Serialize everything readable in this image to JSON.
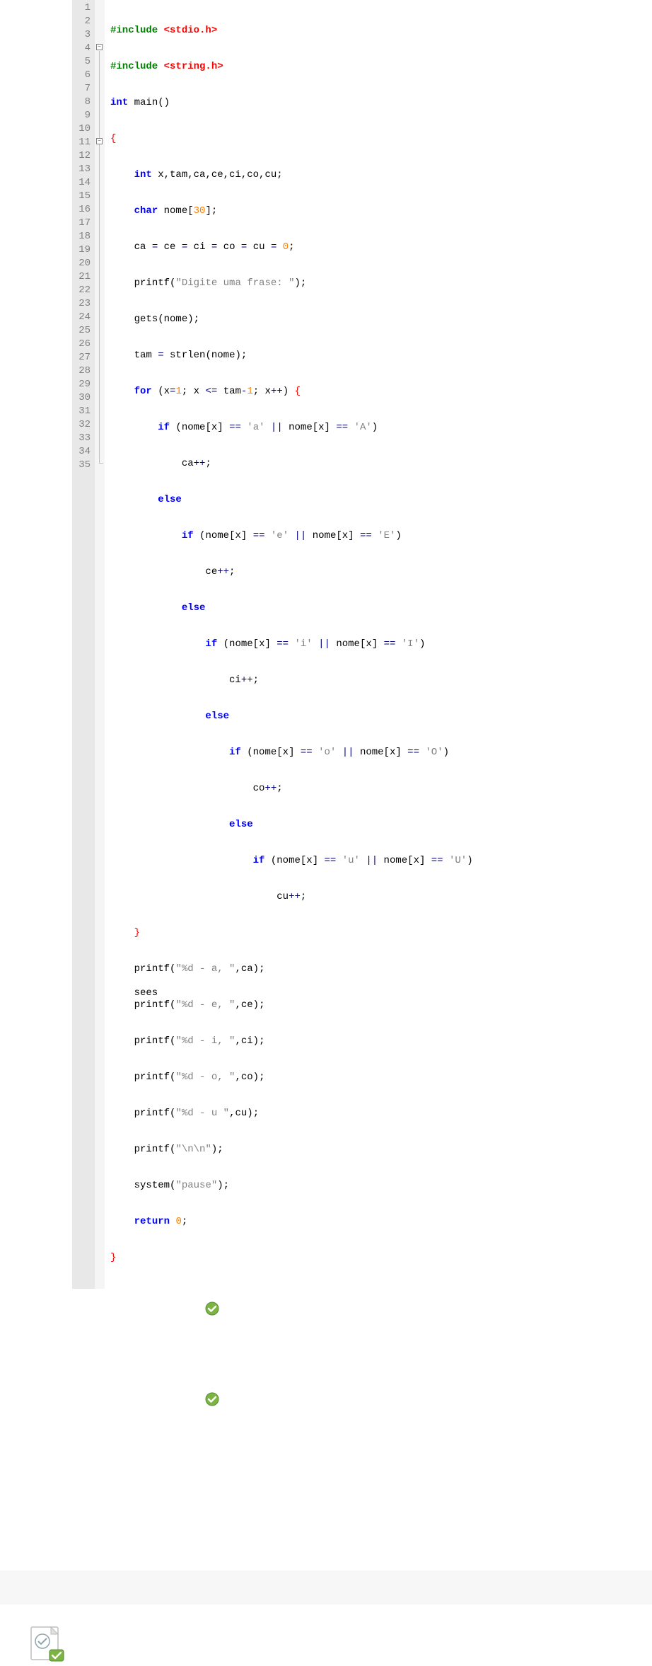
{
  "lines": [
    {
      "n": "1"
    },
    {
      "n": "2"
    },
    {
      "n": "3"
    },
    {
      "n": "4"
    },
    {
      "n": "5"
    },
    {
      "n": "6"
    },
    {
      "n": "7"
    },
    {
      "n": "8"
    },
    {
      "n": "9"
    },
    {
      "n": "10"
    },
    {
      "n": "11"
    },
    {
      "n": "12"
    },
    {
      "n": "13"
    },
    {
      "n": "14"
    },
    {
      "n": "15"
    },
    {
      "n": "16"
    },
    {
      "n": "17"
    },
    {
      "n": "18"
    },
    {
      "n": "19"
    },
    {
      "n": "20"
    },
    {
      "n": "21"
    },
    {
      "n": "22"
    },
    {
      "n": "23"
    },
    {
      "n": "24"
    },
    {
      "n": "25"
    },
    {
      "n": "26"
    },
    {
      "n": "27"
    },
    {
      "n": "28"
    },
    {
      "n": "29"
    },
    {
      "n": "30"
    },
    {
      "n": "31"
    },
    {
      "n": "32"
    },
    {
      "n": "33"
    },
    {
      "n": "34"
    },
    {
      "n": "35"
    }
  ],
  "code": {
    "l1_include": "#include ",
    "l1_hdr": "<stdio.h>",
    "l2_include": "#include ",
    "l2_hdr": "<string.h>",
    "l3_int": "int",
    "l3_main": " main",
    "l3_p": "()",
    "l4_brace": "{",
    "l5_int": "int",
    "l5_vars": " x,tam,ca,ce,ci,co,cu",
    "l5_semi": ";",
    "l6_char": "char",
    "l6_nome": " nome",
    "l6_br": "[",
    "l6_30": "30",
    "l6_bre": "]",
    "l6_semi": ";",
    "l7_a": "ca ",
    "l7_eq": "= ",
    "l7_b": "ce ",
    "l7_c": "ci ",
    "l7_d": "co ",
    "l7_e": "cu ",
    "l7_zero": "0",
    "l7_semi": ";",
    "l8_printf": "printf",
    "l8_p1": "(",
    "l8_str": "\"Digite uma frase: \"",
    "l8_p2": ")",
    "l8_semi": ";",
    "l9_gets": "gets",
    "l9_p1": "(",
    "l9_nome": "nome",
    "l9_p2": ")",
    "l9_semi": ";",
    "l10_tam": "tam ",
    "l10_eq": "= ",
    "l10_strlen": "strlen",
    "l10_p1": "(",
    "l10_nome": "nome",
    "l10_p2": ")",
    "l10_semi": ";",
    "l11_for": "for",
    "l11_p1": " (",
    "l11_x": "x",
    "l11_eq": "=",
    "l11_1": "1",
    "l11_semi1": "; ",
    "l11_x2": "x ",
    "l11_le": "<= ",
    "l11_tam": "tam",
    "l11_minus": "-",
    "l11_1b": "1",
    "l11_semi2": "; ",
    "l11_xpp": "x",
    "l11_pp": "++",
    "l11_p2": ") ",
    "l11_brace": "{",
    "l12_if": "if",
    "l12_p1": " (",
    "l12_nome1": "nome",
    "l12_br1": "[",
    "l12_x1": "x",
    "l12_bre1": "] ",
    "l12_eq1": "== ",
    "l12_a": "'a'",
    "l12_or": " || ",
    "l12_nome2": "nome",
    "l12_br2": "[",
    "l12_x2": "x",
    "l12_bre2": "] ",
    "l12_eq2": "== ",
    "l12_A": "'A'",
    "l12_p2": ")",
    "l13_ca": "ca",
    "l13_pp": "++",
    "l13_semi": ";",
    "l14_else": "else",
    "l15_if": "if",
    "l15_p1": " (",
    "l15_nome1": "nome",
    "l15_br1": "[",
    "l15_x1": "x",
    "l15_bre1": "] ",
    "l15_eq1": "== ",
    "l15_e": "'e'",
    "l15_or": " || ",
    "l15_nome2": "nome",
    "l15_br2": "[",
    "l15_x2": "x",
    "l15_bre2": "] ",
    "l15_eq2": "== ",
    "l15_E": "'E'",
    "l15_p2": ")",
    "l16_ce": "ce",
    "l16_pp": "++",
    "l16_semi": ";",
    "l17_else": "else",
    "l18_if": "if",
    "l18_p1": " (",
    "l18_nome1": "nome",
    "l18_br1": "[",
    "l18_x1": "x",
    "l18_bre1": "] ",
    "l18_eq1": "== ",
    "l18_i": "'i'",
    "l18_or": " || ",
    "l18_nome2": "nome",
    "l18_br2": "[",
    "l18_x2": "x",
    "l18_bre2": "] ",
    "l18_eq2": "== ",
    "l18_I": "'I'",
    "l18_p2": ")",
    "l19_ci": "ci",
    "l19_pp": "++",
    "l19_semi": ";",
    "l20_else": "else",
    "l21_if": "if",
    "l21_p1": " (",
    "l21_nome1": "nome",
    "l21_br1": "[",
    "l21_x1": "x",
    "l21_bre1": "] ",
    "l21_eq1": "== ",
    "l21_o": "'o'",
    "l21_or": " || ",
    "l21_nome2": "nome",
    "l21_br2": "[",
    "l21_x2": "x",
    "l21_bre2": "] ",
    "l21_eq2": "== ",
    "l21_O": "'O'",
    "l21_p2": ")",
    "l22_co": "co",
    "l22_pp": "++",
    "l22_semi": ";",
    "l23_else": "else",
    "l24_if": "if",
    "l24_p1": " (",
    "l24_nome1": "nome",
    "l24_br1": "[",
    "l24_x1": "x",
    "l24_bre1": "] ",
    "l24_eq1": "== ",
    "l24_u": "'u'",
    "l24_or": " || ",
    "l24_nome2": "nome",
    "l24_br2": "[",
    "l24_x2": "x",
    "l24_bre2": "] ",
    "l24_eq2": "== ",
    "l24_U": "'U'",
    "l24_p2": ")",
    "l25_cu": "cu",
    "l25_pp": "++",
    "l25_semi": ";",
    "l26_brace": "}",
    "l27_printf": "printf",
    "l27_p1": "(",
    "l27_str": "\"%d - a, \"",
    "l27_c": ",ca",
    "l27_p2": ")",
    "l27_semi": ";",
    "l28_printf": "printf",
    "l28_p1": "(",
    "l28_str": "\"%d - e, \"",
    "l28_c": ",ce",
    "l28_p2": ")",
    "l28_semi": ";",
    "l29_printf": "printf",
    "l29_p1": "(",
    "l29_str": "\"%d - i, \"",
    "l29_c": ",ci",
    "l29_p2": ")",
    "l29_semi": ";",
    "l30_printf": "printf",
    "l30_p1": "(",
    "l30_str": "\"%d - o, \"",
    "l30_c": ",co",
    "l30_p2": ")",
    "l30_semi": ";",
    "l31_printf": "printf",
    "l31_p1": "(",
    "l31_str": "\"%d - u \"",
    "l31_c": ",cu",
    "l31_p2": ")",
    "l31_semi": ";",
    "l32_printf": "printf",
    "l32_p1": "(",
    "l32_str": "\"\\n\\n\"",
    "l32_p2": ")",
    "l32_semi": ";",
    "l33_system": "system",
    "l33_p1": "(",
    "l33_str": "\"pause\"",
    "l33_p2": ")",
    "l33_semi": ";",
    "l34_return": "return",
    "l34_sp": " ",
    "l34_zero": "0",
    "l34_semi": ";",
    "l35_brace": "}"
  },
  "fold": {
    "minus": "−"
  }
}
